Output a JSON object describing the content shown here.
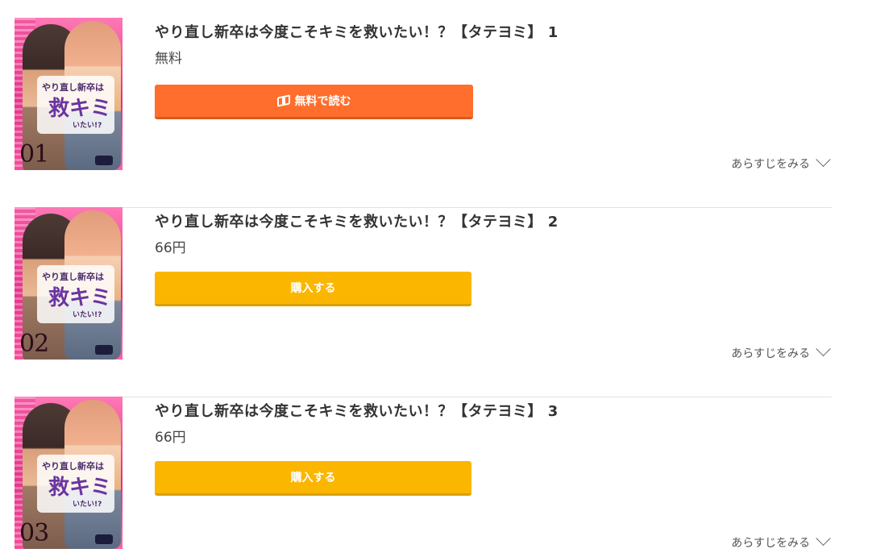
{
  "volumes": [
    {
      "title": "やり直し新卒は今度こそキミを救いたい！？【タテヨミ】 1",
      "price": "無料",
      "button_label": "無料で読む",
      "button_icon": "book-open-icon",
      "button_color": "#ff6e2c",
      "synopsis_label": "あらすじをみる",
      "cover_number": "01",
      "cover_logo_small": "やり直し新卒は",
      "cover_logo_big": "救キミ",
      "cover_logo_tail": "いたい!?"
    },
    {
      "title": "やり直し新卒は今度こそキミを救いたい！？【タテヨミ】 2",
      "price": "66円",
      "button_label": "購入する",
      "button_color": "#fbb600",
      "synopsis_label": "あらすじをみる",
      "cover_number": "02",
      "cover_logo_small": "やり直し新卒は",
      "cover_logo_big": "救キミ",
      "cover_logo_tail": "いたい!?"
    },
    {
      "title": "やり直し新卒は今度こそキミを救いたい！？【タテヨミ】 3",
      "price": "66円",
      "button_label": "購入する",
      "button_color": "#fbb600",
      "synopsis_label": "あらすじをみる",
      "cover_number": "03",
      "cover_logo_small": "やり直し新卒は",
      "cover_logo_big": "救キミ",
      "cover_logo_tail": "いたい!?"
    }
  ]
}
